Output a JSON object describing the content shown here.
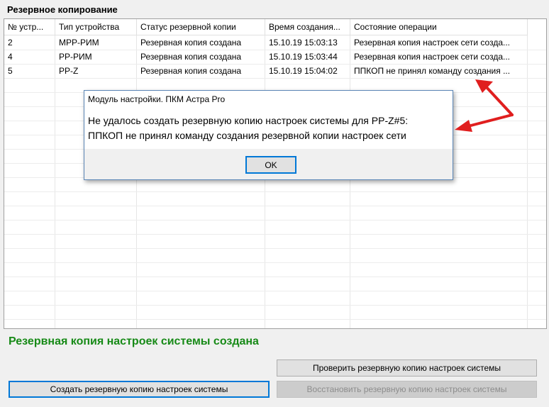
{
  "section_title": "Резервное копирование",
  "table": {
    "columns": [
      "№ устр...",
      "Тип устройства",
      "Статус резервной копии",
      "Время создания...",
      "Состояние операции"
    ],
    "rows": [
      [
        "2",
        "МРР-РИМ",
        "Резервная копия создана",
        "15.10.19 15:03:13",
        "Резервная копия настроек сети созда..."
      ],
      [
        "4",
        "РР-РИМ",
        "Резервная копия создана",
        "15.10.19 15:03:44",
        "Резервная копия настроек сети созда..."
      ],
      [
        "5",
        "РР-Z",
        "Резервная копия создана",
        "15.10.19 15:04:02",
        "ППКОП не принял команду создания ..."
      ]
    ]
  },
  "dialog": {
    "title": "Модуль настройки. ПКМ Астра Pro",
    "message_line1": "Не удалось создать резервную копию настроек системы для РР-Z#5:",
    "message_line2": "ППКОП не принял команду создания резервной копии настроек сети",
    "ok_label": "OK"
  },
  "status_message": "Резервная копия настроек системы создана",
  "buttons": {
    "check_label": "Проверить резервную копию настроек системы",
    "create_label": "Создать резервную копию настроек системы",
    "restore_label": "Восстановить резервную копию настроек системы"
  },
  "colors": {
    "status_green": "#178a17",
    "annotation_arrow": "#e01e1e",
    "focus_border": "#0078d7"
  }
}
